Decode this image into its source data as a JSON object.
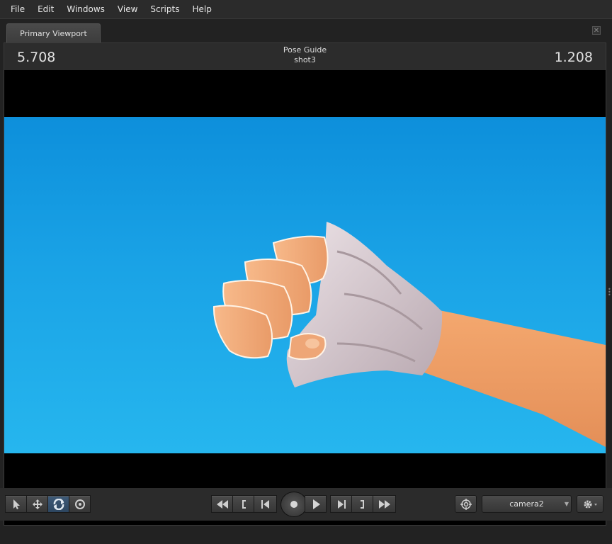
{
  "menu": [
    "File",
    "Edit",
    "Windows",
    "View",
    "Scripts",
    "Help"
  ],
  "tab": {
    "label": "Primary Viewport",
    "close_icon": "close-icon"
  },
  "hud": {
    "left_value": "5.708",
    "right_value": "1.208",
    "title": "Pose Guide",
    "shot": "shot3"
  },
  "viewport": {
    "sky_color_top": "#0d8fdb",
    "sky_color_bottom": "#26b6ee",
    "skin_color": "#f0a068",
    "wrap_color": "#d8c8cc"
  },
  "toolbar": {
    "tools": [
      "select-arrow-icon",
      "move-icon",
      "orbit-icon",
      "target-icon"
    ],
    "transport": [
      "rewind-icon",
      "range-start-icon",
      "step-back-icon",
      "record-icon",
      "play-icon",
      "step-forward-icon",
      "range-end-icon",
      "fast-forward-icon"
    ],
    "camera_value": "camera2",
    "camera_icon": "crosshair-icon",
    "settings_icon": "gear-icon"
  }
}
